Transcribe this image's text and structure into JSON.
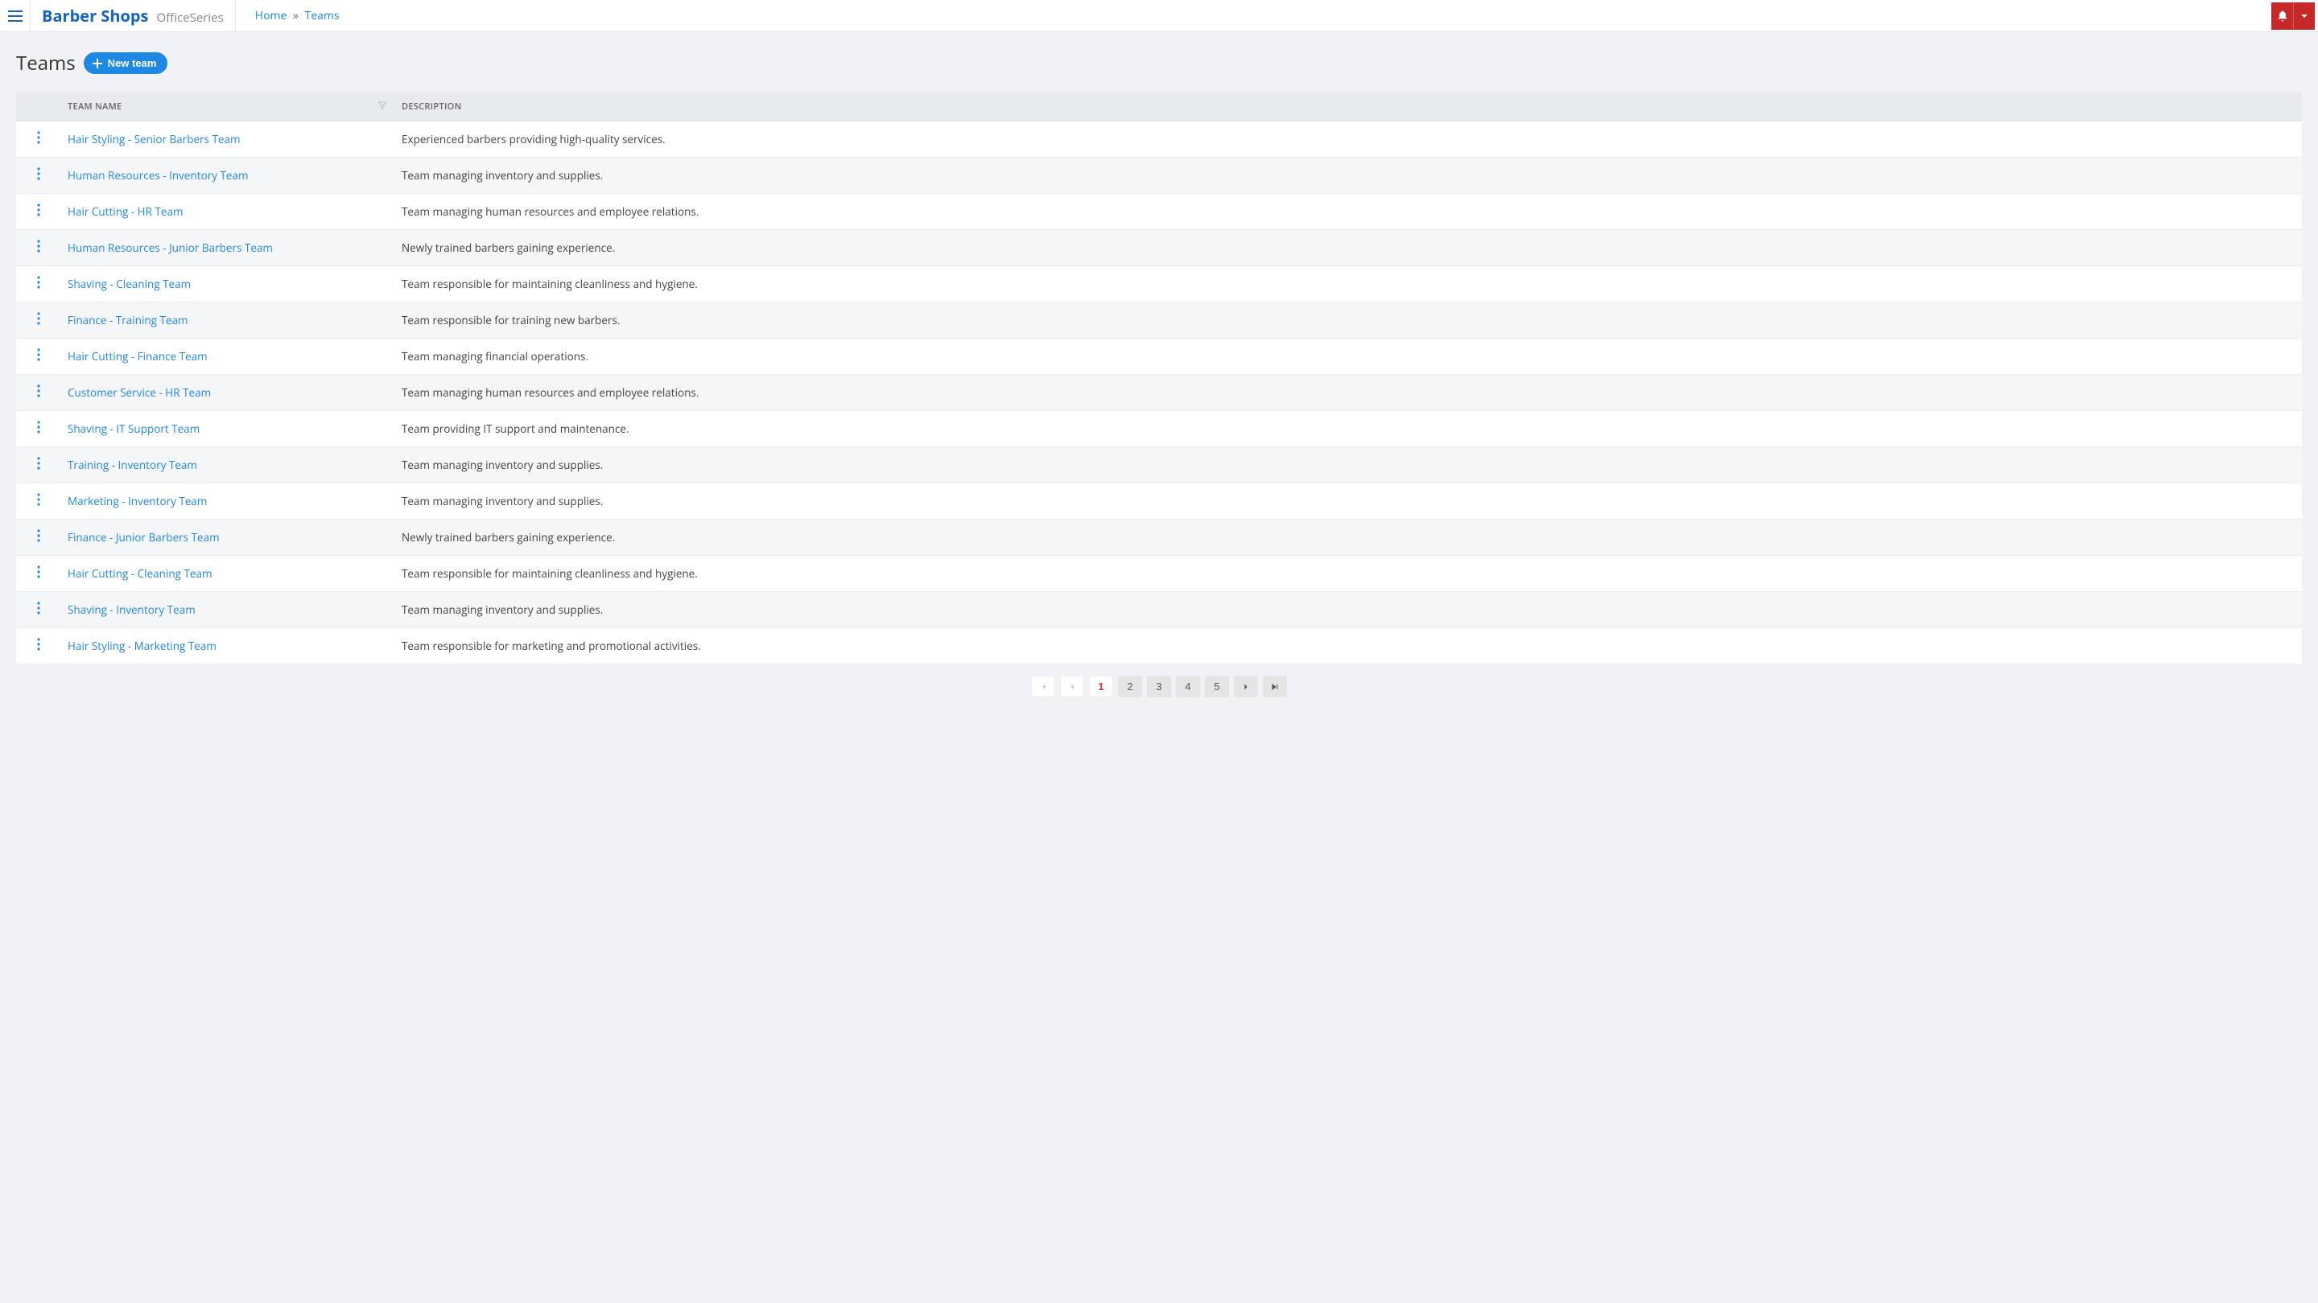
{
  "header": {
    "brand_name": "Barber Shops",
    "brand_sub": "OfficeSeries"
  },
  "breadcrumb": {
    "home": "Home",
    "current": "Teams"
  },
  "page": {
    "title": "Teams",
    "new_button": "New team"
  },
  "table": {
    "columns": {
      "name": "Team Name",
      "description": "Description"
    }
  },
  "teams": [
    {
      "name": "Hair Styling - Senior Barbers Team",
      "desc": "Experienced barbers providing high-quality services."
    },
    {
      "name": "Human Resources - Inventory Team",
      "desc": "Team managing inventory and supplies."
    },
    {
      "name": "Hair Cutting - HR Team",
      "desc": "Team managing human resources and employee relations."
    },
    {
      "name": "Human Resources - Junior Barbers Team",
      "desc": "Newly trained barbers gaining experience."
    },
    {
      "name": "Shaving - Cleaning Team",
      "desc": "Team responsible for maintaining cleanliness and hygiene."
    },
    {
      "name": "Finance - Training Team",
      "desc": "Team responsible for training new barbers."
    },
    {
      "name": "Hair Cutting - Finance Team",
      "desc": "Team managing financial operations."
    },
    {
      "name": "Customer Service - HR Team",
      "desc": "Team managing human resources and employee relations."
    },
    {
      "name": "Shaving - IT Support Team",
      "desc": "Team providing IT support and maintenance."
    },
    {
      "name": "Training - Inventory Team",
      "desc": "Team managing inventory and supplies."
    },
    {
      "name": "Marketing - Inventory Team",
      "desc": "Team managing inventory and supplies."
    },
    {
      "name": "Finance - Junior Barbers Team",
      "desc": "Newly trained barbers gaining experience."
    },
    {
      "name": "Hair Cutting - Cleaning Team",
      "desc": "Team responsible for maintaining cleanliness and hygiene."
    },
    {
      "name": "Shaving - Inventory Team",
      "desc": "Team managing inventory and supplies."
    },
    {
      "name": "Hair Styling - Marketing Team",
      "desc": "Team responsible for marketing and promotional activities."
    }
  ],
  "pagination": {
    "pages": [
      "1",
      "2",
      "3",
      "4",
      "5"
    ],
    "current": "1"
  }
}
